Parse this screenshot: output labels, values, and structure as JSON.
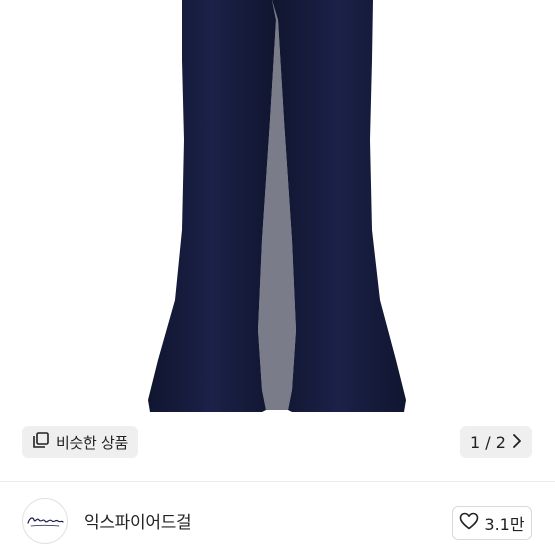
{
  "product": {
    "image_alt": "navy flared pants",
    "similar_label": "비슷한 상품",
    "pager": "1 / 2"
  },
  "seller": {
    "name": "익스파이어드걸",
    "logo_text": "Expired girl",
    "like_count": "3.1만"
  },
  "colors": {
    "pants": "#151a3c",
    "chip_bg": "#efefef"
  },
  "icons": {
    "similar": "copy-squares-icon",
    "pager_next": "chevron-right-icon",
    "like": "heart-outline-icon"
  }
}
